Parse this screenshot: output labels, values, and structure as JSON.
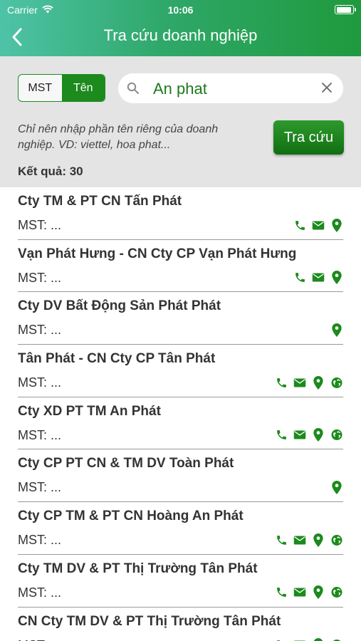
{
  "status_bar": {
    "carrier": "Carrier",
    "time": "10:06"
  },
  "header": {
    "title": "Tra cứu doanh nghiệp"
  },
  "search": {
    "mode_mst": "MST",
    "mode_ten": "Tên",
    "selected_mode": "Tên",
    "query": "An phat",
    "hint": "Chỉ nên nhập phần tên riêng của doanh nghiệp. VD: viettel, hoa phat...",
    "button_label": "Tra cứu",
    "result_count": "Kết quả: 30"
  },
  "colors": {
    "accent": "#1c8a1c",
    "header_start": "#4fc3a7",
    "header_end": "#1f9a3d"
  },
  "results": [
    {
      "name": "Cty TM & PT CN Tấn Phát",
      "mst": "MST: ...",
      "icons": [
        "phone-icon",
        "mail-icon",
        "location-icon"
      ]
    },
    {
      "name": "Vạn Phát Hưng - CN Cty CP Vạn Phát Hưng",
      "mst": "MST: ...",
      "icons": [
        "phone-icon",
        "mail-icon",
        "location-icon"
      ]
    },
    {
      "name": "Cty DV Bất Động Sản Phát Phát",
      "mst": "MST: ...",
      "icons": [
        "location-icon"
      ]
    },
    {
      "name": "Tân Phát - CN Cty CP Tân Phát",
      "mst": "MST: ...",
      "icons": [
        "phone-icon",
        "mail-icon",
        "location-icon",
        "web-icon"
      ]
    },
    {
      "name": "Cty XD PT TM An Phát",
      "mst": "MST: ...",
      "icons": [
        "phone-icon",
        "mail-icon",
        "location-icon",
        "web-icon"
      ]
    },
    {
      "name": "Cty CP PT CN & TM DV Toàn Phát",
      "mst": "MST: ...",
      "icons": [
        "location-icon"
      ]
    },
    {
      "name": "Cty CP TM & PT CN Hoàng An Phát",
      "mst": "MST: ...",
      "icons": [
        "phone-icon",
        "mail-icon",
        "location-icon",
        "web-icon"
      ]
    },
    {
      "name": "Cty TM DV & PT Thị Trường Tân Phát",
      "mst": "MST: ...",
      "icons": [
        "phone-icon",
        "mail-icon",
        "location-icon",
        "web-icon"
      ]
    },
    {
      "name": "CN Cty TM DV & PT Thị Trường Tân Phát",
      "mst": "MST: ...",
      "icons": [
        "phone-icon",
        "mail-icon",
        "location-icon",
        "web-icon"
      ]
    }
  ]
}
